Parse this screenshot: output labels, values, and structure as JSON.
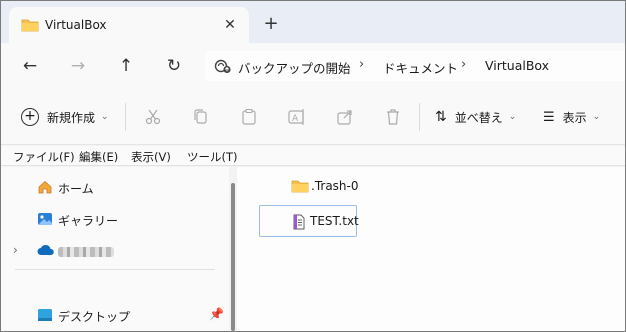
{
  "window": {
    "tab_title": "VirtualBox",
    "tab_close": "✕",
    "new_tab": "+"
  },
  "nav": {
    "back": "←",
    "forward": "→",
    "up": "↑",
    "refresh": "↻"
  },
  "address": {
    "crumbs": [
      "バックアップの開始",
      "ドキュメント",
      "VirtualBox"
    ],
    "separator": "›"
  },
  "toolbar": {
    "new_label": "新規作成",
    "sort_label": "並べ替え",
    "view_label": "表示"
  },
  "menubar": [
    "ファイル(F)",
    "編集(E)",
    "表示(V)",
    "ツール(T)"
  ],
  "sidebar": {
    "items": [
      {
        "label": "ホーム",
        "icon": "home-icon"
      },
      {
        "label": "ギャラリー",
        "icon": "gallery-icon"
      },
      {
        "label": "",
        "icon": "onedrive-cloud-icon"
      },
      {
        "label": "デスクトップ",
        "icon": "desktop-icon"
      }
    ]
  },
  "files": [
    {
      "name": ".Trash-0",
      "icon": "folder-icon"
    },
    {
      "name": "TEST.txt",
      "icon": "text-file-icon"
    }
  ],
  "colors": {
    "accent": "#0067c0",
    "folder": "#f4c04e",
    "selection_border": "#9bbfe3"
  }
}
